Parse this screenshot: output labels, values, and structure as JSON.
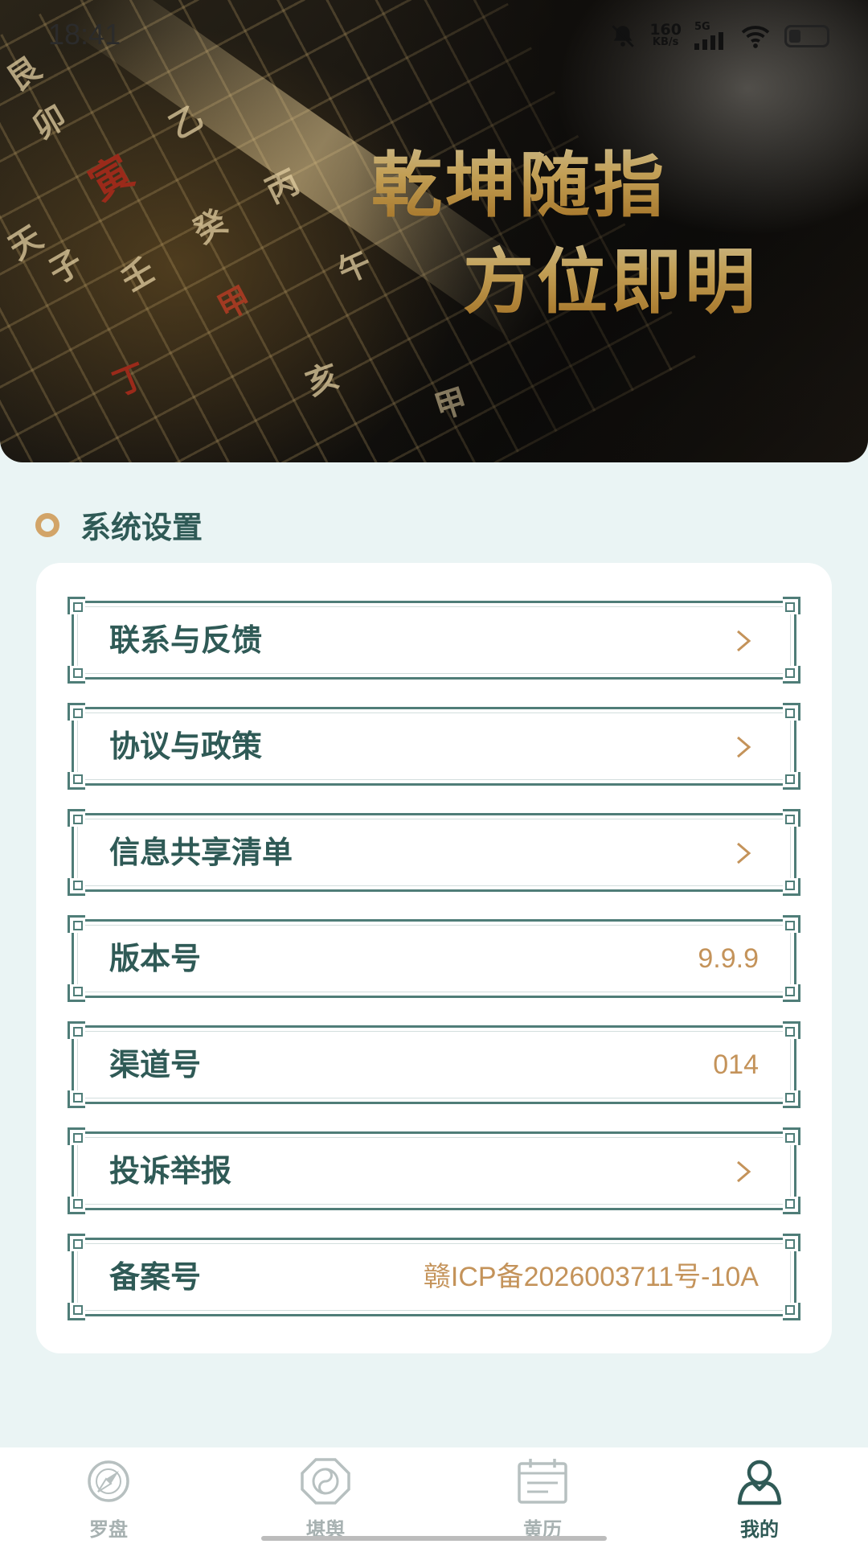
{
  "status_bar": {
    "time": "18:41",
    "net_speed_value": "160",
    "net_speed_unit": "KB/s",
    "network": "5G",
    "icons": [
      "bell-muted-icon",
      "signal-icon",
      "wifi-icon",
      "battery-icon"
    ]
  },
  "hero": {
    "line1": "乾坤随指",
    "line2": "方位即明",
    "glyphs": [
      "寅",
      "甲",
      "卯",
      "乙",
      "丙",
      "午",
      "丁",
      "艮",
      "子",
      "亥",
      "壬",
      "癸",
      "天",
      "甲"
    ]
  },
  "section": {
    "title": "系统设置"
  },
  "settings": {
    "items": [
      {
        "label": "联系与反馈",
        "value": "",
        "chevron": true
      },
      {
        "label": "协议与政策",
        "value": "",
        "chevron": true
      },
      {
        "label": "信息共享清单",
        "value": "",
        "chevron": true
      },
      {
        "label": "版本号",
        "value": "9.9.9",
        "chevron": false
      },
      {
        "label": "渠道号",
        "value": "014",
        "chevron": false
      },
      {
        "label": "投诉举报",
        "value": "",
        "chevron": true
      },
      {
        "label": "备案号",
        "value": "赣ICP备2026003711号-10A",
        "chevron": false
      }
    ]
  },
  "bottom_nav": {
    "items": [
      {
        "label": "罗盘",
        "icon": "compass-icon",
        "active": false
      },
      {
        "label": "堪舆",
        "icon": "bagua-icon",
        "active": false
      },
      {
        "label": "黄历",
        "icon": "calendar-icon",
        "active": false
      },
      {
        "label": "我的",
        "icon": "profile-icon",
        "active": true
      }
    ]
  },
  "colors": {
    "accent": "#2f5a56",
    "border": "#4f7d78",
    "value_gold": "#c4935a",
    "background": "#eaf4f4",
    "inactive_nav": "#a7b1b1"
  }
}
